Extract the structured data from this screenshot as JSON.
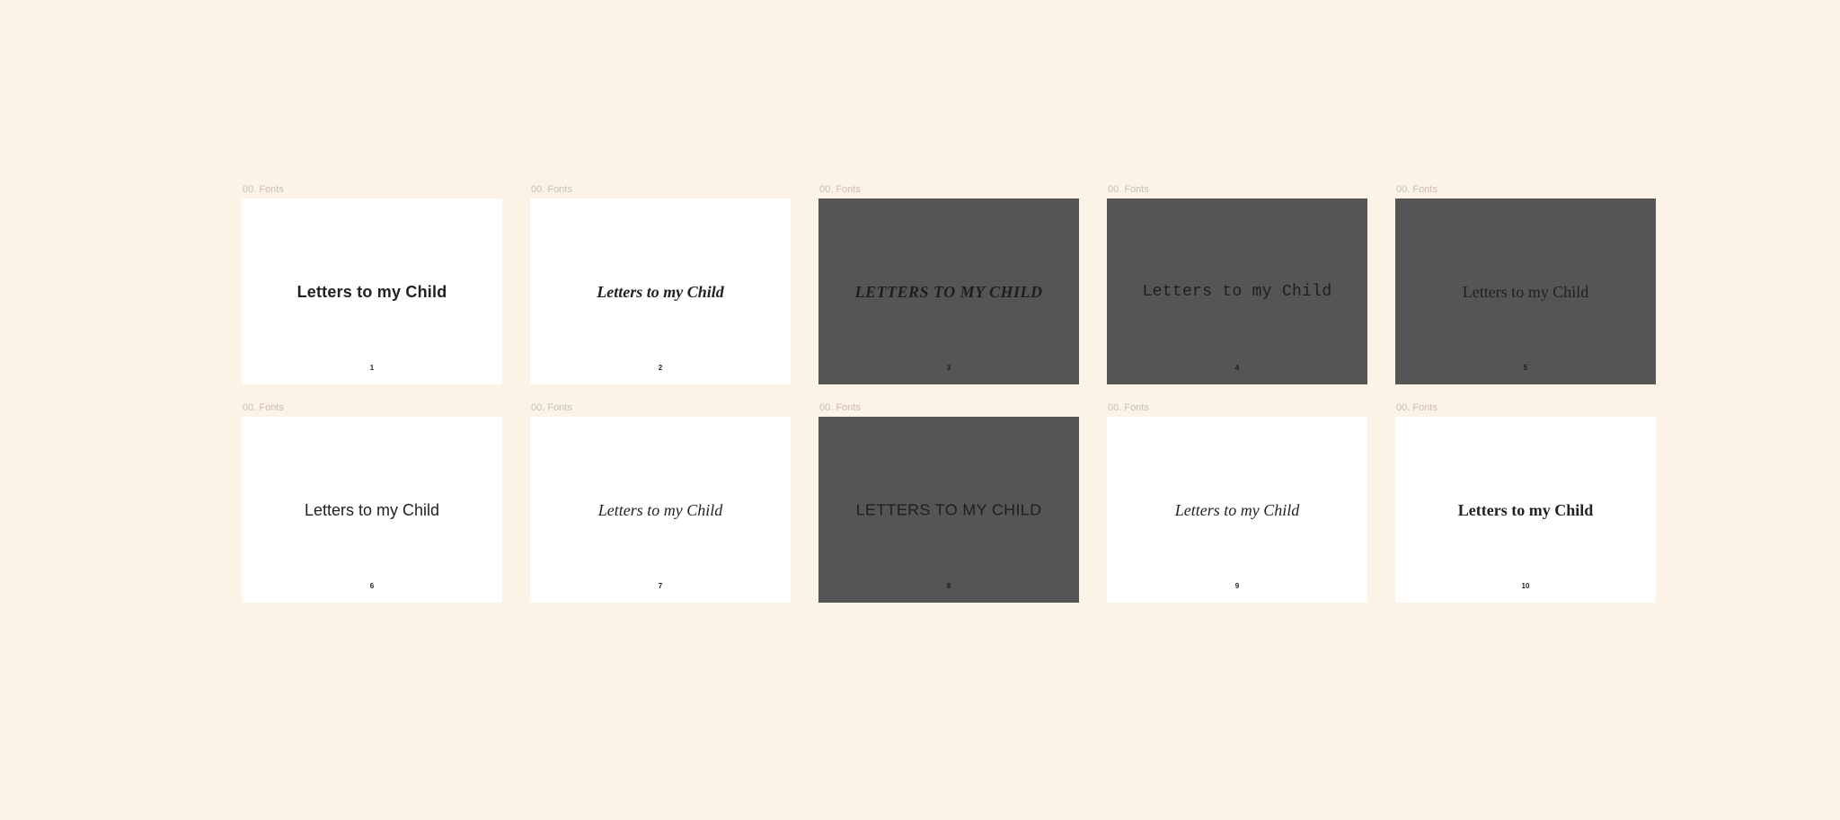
{
  "section_label": "00. Fonts",
  "cards": [
    {
      "index": "1",
      "text": "Letters to my Child",
      "theme": "light",
      "style": "s1"
    },
    {
      "index": "2",
      "text": "Letters to my Child",
      "theme": "light",
      "style": "s2"
    },
    {
      "index": "3",
      "text": "LETTERS TO MY CHILD",
      "theme": "dark",
      "style": "s3"
    },
    {
      "index": "4",
      "text": "Letters to my Child",
      "theme": "dark",
      "style": "s4"
    },
    {
      "index": "5",
      "text": "Letters to my Child",
      "theme": "dark",
      "style": "s5"
    },
    {
      "index": "6",
      "text": "Letters to my Child",
      "theme": "light",
      "style": "s6"
    },
    {
      "index": "7",
      "text": "Letters to my Child",
      "theme": "light",
      "style": "s7"
    },
    {
      "index": "8",
      "text": "Letters to my Child",
      "theme": "dark",
      "style": "s8"
    },
    {
      "index": "9",
      "text": "Letters to my Child",
      "theme": "light",
      "style": "s9"
    },
    {
      "index": "10",
      "text": "Letters to my Child",
      "theme": "light",
      "style": "s10"
    }
  ]
}
